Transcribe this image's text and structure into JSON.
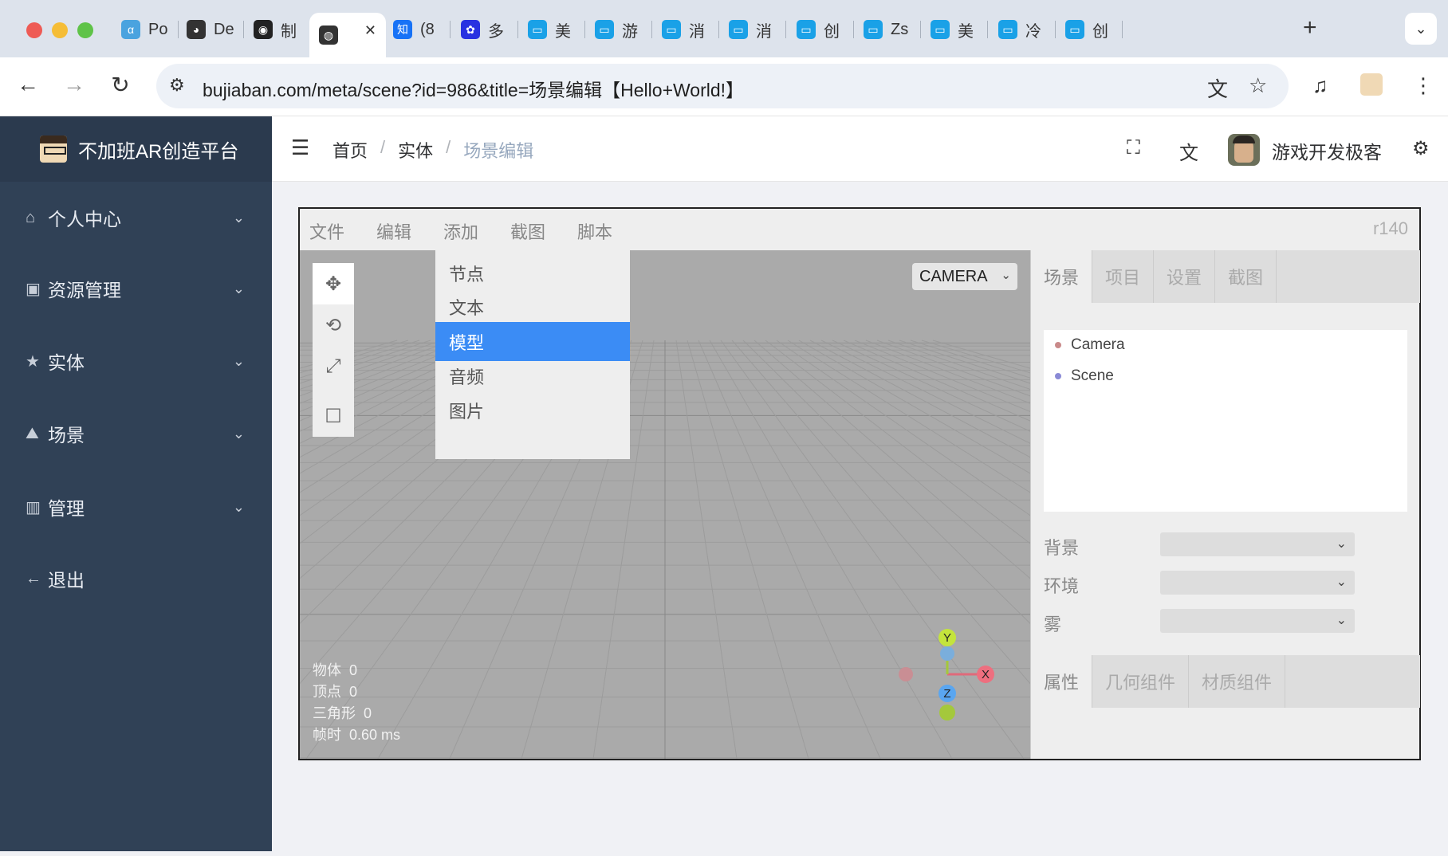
{
  "browser": {
    "tabs": [
      {
        "label": "Po",
        "icon": "alpha-icon",
        "color": "#4aa3df"
      },
      {
        "label": "De",
        "icon": "ollama-icon",
        "color": "#333333"
      },
      {
        "label": "制",
        "icon": "eye-icon",
        "color": "#222222"
      },
      {
        "label": "",
        "icon": "globe-icon",
        "color": "#333333"
      },
      {
        "label": "(8",
        "icon": "zhihu-icon",
        "color": "#1772f6"
      },
      {
        "label": "多",
        "icon": "baidu-icon",
        "color": "#2932e1"
      },
      {
        "label": "美",
        "icon": "bilibili-icon",
        "color": "#1aa1e7"
      },
      {
        "label": "游",
        "icon": "bilibili-icon",
        "color": "#1aa1e7"
      },
      {
        "label": "消",
        "icon": "bilibili-icon",
        "color": "#1aa1e7"
      },
      {
        "label": "消",
        "icon": "bilibili-icon",
        "color": "#1aa1e7"
      },
      {
        "label": "创",
        "icon": "bilibili-icon",
        "color": "#1aa1e7"
      },
      {
        "label": "Zs",
        "icon": "bilibili-icon",
        "color": "#1aa1e7"
      },
      {
        "label": "美",
        "icon": "bilibili-icon",
        "color": "#1aa1e7"
      },
      {
        "label": "冷",
        "icon": "bilibili-icon",
        "color": "#1aa1e7"
      },
      {
        "label": "创",
        "icon": "bilibili-icon",
        "color": "#1aa1e7"
      }
    ],
    "new_tab": "+",
    "url": "bujiaban.com/meta/scene?id=986&title=场景编辑【Hello+World!】"
  },
  "app": {
    "brand": "不加班AR创造平台",
    "menu": [
      {
        "label": "个人中心",
        "icon": "home-icon"
      },
      {
        "label": "资源管理",
        "icon": "resource-icon"
      },
      {
        "label": "实体",
        "icon": "star-icon"
      },
      {
        "label": "场景",
        "icon": "scene-icon"
      },
      {
        "label": "管理",
        "icon": "manage-icon"
      },
      {
        "label": "退出",
        "icon": "arrow-left-icon"
      }
    ],
    "breadcrumb": [
      "首页",
      "实体",
      "场景编辑"
    ],
    "username": "游戏开发极客"
  },
  "editor": {
    "menubar": [
      "文件",
      "编辑",
      "添加",
      "截图",
      "脚本"
    ],
    "version": "r140",
    "camera_select": "CAMERA",
    "add_menu": [
      "节点",
      "文本",
      "模型",
      "音频",
      "图片"
    ],
    "add_menu_highlight": "模型",
    "stats": [
      {
        "label": "物体",
        "value": "0"
      },
      {
        "label": "顶点",
        "value": "0"
      },
      {
        "label": "三角形",
        "value": "0"
      },
      {
        "label": "帧时",
        "value": "0.60 ms"
      }
    ],
    "axes": {
      "x": "X",
      "y": "Y",
      "z": "Z"
    },
    "sidebar_tabs": [
      "场景",
      "项目",
      "设置",
      "截图"
    ],
    "outliner": [
      {
        "label": "Camera",
        "color": "#c98a8a"
      },
      {
        "label": "Scene",
        "color": "#8a8ad6"
      }
    ],
    "props": [
      {
        "label": "背景",
        "value": ""
      },
      {
        "label": "环境",
        "value": ""
      },
      {
        "label": "雾",
        "value": ""
      }
    ],
    "bottom_tabs": [
      "属性",
      "几何组件",
      "材质组件"
    ]
  }
}
